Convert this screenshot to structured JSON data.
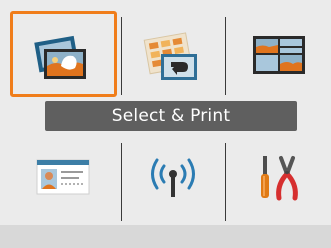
{
  "menu": {
    "selected_label": "Select & Print",
    "items": [
      {
        "id": "photo",
        "icon": "photo-print-icon"
      },
      {
        "id": "select-print",
        "icon": "select-print-icon"
      },
      {
        "id": "layout",
        "icon": "layout-print-icon"
      },
      {
        "id": "id-card",
        "icon": "id-card-icon"
      },
      {
        "id": "wireless",
        "icon": "wireless-icon"
      },
      {
        "id": "tools",
        "icon": "tools-icon"
      }
    ]
  },
  "colors": {
    "selection": "#f07d1a",
    "banner_bg": "#5f5f5f",
    "background": "#ebebeb"
  }
}
